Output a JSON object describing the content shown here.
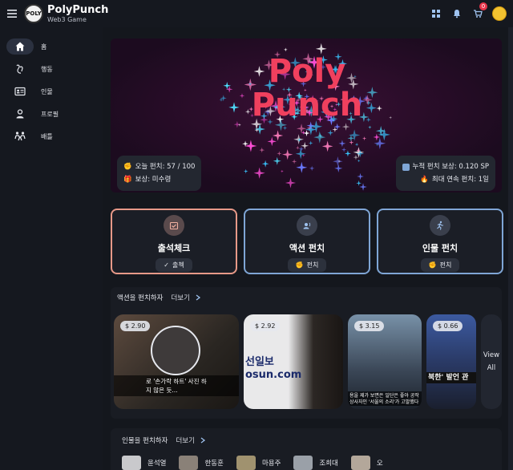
{
  "app": {
    "name": "PolyPunch",
    "subtitle": "Web3 Game",
    "logo_text": "POLY"
  },
  "topbar": {
    "notification_count": "0",
    "icons": [
      "grid-icon",
      "bell-icon",
      "cart-icon"
    ]
  },
  "sidebar": {
    "items": [
      {
        "label": "홈",
        "icon": "home-icon",
        "active": true
      },
      {
        "label": "행동",
        "icon": "gesture-icon",
        "active": false
      },
      {
        "label": "인물",
        "icon": "id-card-icon",
        "active": false
      },
      {
        "label": "프로필",
        "icon": "person-icon",
        "active": false
      },
      {
        "label": "배틀",
        "icon": "battle-icon",
        "active": false
      }
    ]
  },
  "hero": {
    "title": "Poly Punch",
    "today_punch_label": "오늘 펀치: 57 / 100",
    "reward_label": "보상: 미수령",
    "total_reward_label": "누적 펀치 보상: 0.120 SP",
    "max_streak_label": "최대 연속 펀치: 1일"
  },
  "actions": [
    {
      "title": "출석체크",
      "button": "출첵",
      "icon": "calendar-check-icon"
    },
    {
      "title": "액션 펀치",
      "button": "펀치",
      "icon": "voice-icon"
    },
    {
      "title": "인물 펀치",
      "button": "펀치",
      "icon": "running-icon"
    }
  ],
  "action_section": {
    "title": "액션을 펀치하자",
    "more": "더보기",
    "cards": [
      {
        "price": "$ 2.90",
        "caption": "로 '손가락 하트' 사진 하지 않은 듯..."
      },
      {
        "price": "$ 2.92",
        "caption": "선일보 osun.com"
      },
      {
        "price": "$ 3.15",
        "caption": "용을 제가 보면은 일단은 좋아 공작 상사자인 '서울의 소리'가 고발했다"
      },
      {
        "price": "$ 0.66",
        "caption": "북한' 발언 관"
      }
    ],
    "view_all": "View All"
  },
  "people_section": {
    "title": "인물을 펀치하자",
    "more": "더보기",
    "people": [
      {
        "name": "윤석열"
      },
      {
        "name": "한동훈"
      },
      {
        "name": "마용주"
      },
      {
        "name": "조희대"
      },
      {
        "name": "오"
      }
    ]
  },
  "colors": {
    "accent_pink": "#f0405e",
    "card_border_blue": "#7fa6d6",
    "card_border_peach": "#e79988",
    "badge_red": "#e8344a"
  }
}
